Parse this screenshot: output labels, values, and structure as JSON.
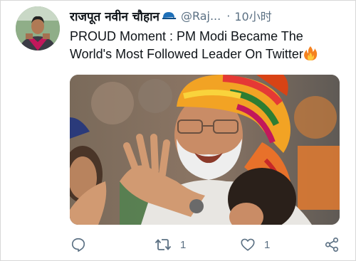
{
  "tweet": {
    "author_name": "राजपूत नवीन चौहान",
    "handle": "@Raj...",
    "separator": "·",
    "time": "10小时",
    "text": "PROUD Moment : PM Modi Became The World's Most Followed Leader On Twitter",
    "media_description": "photo",
    "icons": {
      "badge": "cap-icon",
      "text_emoji": "fire-icon"
    }
  },
  "actions": {
    "reply": {
      "icon": "reply-icon"
    },
    "retweet": {
      "icon": "retweet-icon",
      "count": "1"
    },
    "like": {
      "icon": "heart-icon",
      "count": "1"
    },
    "share": {
      "icon": "share-icon"
    }
  },
  "colors": {
    "text_primary": "#0f1419",
    "text_secondary": "#5b7083",
    "icon_gray": "#5b7083",
    "cap_blue": "#1d6fb8",
    "fire_orange": "#f58220"
  }
}
